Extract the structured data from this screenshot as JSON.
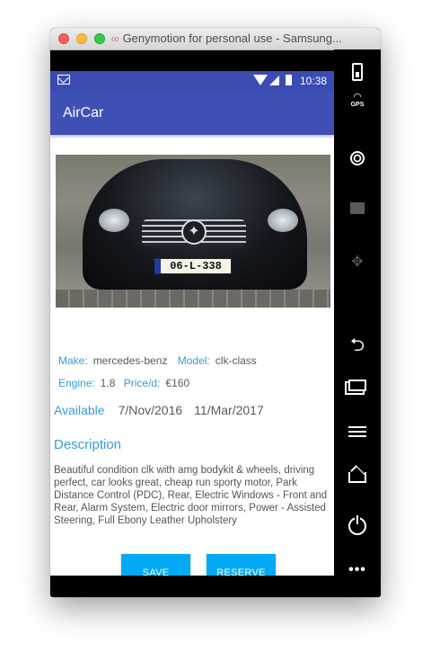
{
  "window": {
    "title": "Genymotion for personal use - Samsung..."
  },
  "statusbar": {
    "time": "10:38"
  },
  "app": {
    "title": "AirCar"
  },
  "car": {
    "plate": "06-L-338",
    "make_label": "Make:",
    "make": "mercedes-benz",
    "model_label": "Model:",
    "model": "clk-class",
    "engine_label": "Engine:",
    "engine": "1.8",
    "price_label": "Price/d:",
    "price": "€160",
    "available_label": "Available",
    "available_from": "7/Nov/2016",
    "available_to": "11/Mar/2017",
    "description_heading": "Description",
    "description": "Beautiful condition clk with amg bodykit & wheels, driving perfect, car looks great, cheap run sporty motor, Park Distance Control (PDC), Rear, Electric Windows - Front and Rear, Alarm System, Electric door mirrors, Power - Assisted Steering, Full Ebony Leather Upholstery"
  },
  "buttons": {
    "save": "SAVE",
    "reserve": "RESERVE"
  },
  "sidebar": {
    "icons": [
      "battery-icon",
      "gps-icon",
      "webcam-icon",
      "clapperboard-icon",
      "dpad-icon",
      "back-icon",
      "recent-apps-icon",
      "menu-icon",
      "home-icon",
      "power-icon",
      "more-icon"
    ],
    "gps_label": "GPS"
  },
  "colors": {
    "appbar": "#3f51b5",
    "statusbar": "#3a4cb2",
    "accent": "#03a9f4",
    "label": "#3b9bd4"
  }
}
